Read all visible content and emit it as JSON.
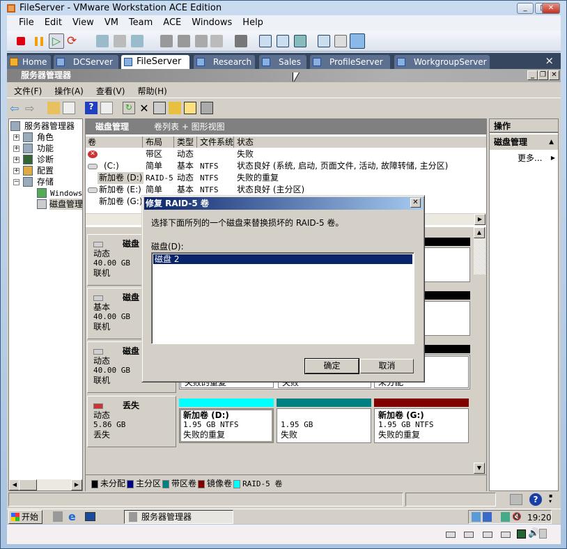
{
  "window": {
    "title": "FileServer - VMware Workstation ACE Edition"
  },
  "menu": [
    "File",
    "Edit",
    "View",
    "VM",
    "Team",
    "ACE",
    "Windows",
    "Help"
  ],
  "tabs": [
    {
      "label": "Home"
    },
    {
      "label": "DCServer"
    },
    {
      "label": "FileServer",
      "active": true
    },
    {
      "label": "Research"
    },
    {
      "label": "Sales"
    },
    {
      "label": "ProfileServer"
    },
    {
      "label": "WorkgroupServer"
    }
  ],
  "tabs_close": "×",
  "guest": {
    "title": "服务器管理器",
    "menu": [
      "文件(F)",
      "操作(A)",
      "查看(V)",
      "帮助(H)"
    ],
    "tree": {
      "root": "服务器管理器",
      "items": [
        "角色",
        "功能",
        "诊断",
        "配置",
        "存储"
      ],
      "children": [
        "Windows",
        "磁盘管理"
      ]
    },
    "center": {
      "title": "磁盘管理",
      "subtitle": "卷列表 + 图形视图",
      "columns": [
        "卷",
        "布局",
        "类型",
        "文件系统",
        "状态"
      ],
      "rows": [
        {
          "volume": "",
          "layout": "带区",
          "type": "动态",
          "fs": "",
          "status": "失败"
        },
        {
          "volume": "(C:)",
          "layout": "简单",
          "type": "基本",
          "fs": "NTFS",
          "status": "状态良好 (系统, 启动, 页面文件, 活动, 故障转储, 主分区)"
        },
        {
          "volume": "新加卷 (D:)",
          "layout": "RAID-5",
          "type": "动态",
          "fs": "NTFS",
          "status": "失败的重复"
        },
        {
          "volume": "新加卷 (E:)",
          "layout": "简单",
          "type": "基本",
          "fs": "NTFS",
          "status": "状态良好 (主分区)"
        },
        {
          "volume": "新加卷 (G:)",
          "layout": "",
          "type": "",
          "fs": "",
          "status": ""
        }
      ],
      "disks": [
        {
          "name": "磁盘",
          "kind": "动态",
          "size": "40.00 GB",
          "state": "联机"
        },
        {
          "name": "磁盘",
          "kind": "基本",
          "size": "40.00 GB",
          "state": "联机"
        },
        {
          "name": "磁盘",
          "kind": "动态",
          "size": "40.00 GB",
          "state": "联机",
          "partitions": [
            "失败的重复",
            "失败",
            "未分配"
          ]
        },
        {
          "name": "丢失",
          "kind": "动态",
          "size": "5.86 GB",
          "state": "丢失",
          "partitions": [
            {
              "name": "新加卷  (D:)",
              "size": "1.95 GB NTFS",
              "status": "失败的重复",
              "color": "#00ffff"
            },
            {
              "name": "",
              "size": "1.95 GB",
              "status": "失败",
              "color": "#008080"
            },
            {
              "name": "新加卷  (G:)",
              "size": "1.95 GB NTFS",
              "status": "失败的重复",
              "color": "#800000"
            }
          ]
        }
      ],
      "legend": [
        {
          "label": "未分配",
          "color": "#000000"
        },
        {
          "label": "主分区",
          "color": "#000080"
        },
        {
          "label": "带区卷",
          "color": "#008080"
        },
        {
          "label": "镜像卷",
          "color": "#800000"
        },
        {
          "label": "RAID-5 卷",
          "color": "#00ffff"
        }
      ]
    },
    "actions": {
      "title": "操作",
      "section": "磁盘管理",
      "more": "更多..."
    },
    "taskbar": {
      "start": "开始",
      "task": "服务器管理器",
      "clock": "19:20"
    }
  },
  "dialog": {
    "title": "修复 RAID-5 卷",
    "instruction": "选择下面所列的一个磁盘来替换损坏的 RAID-5 卷。",
    "list_label": "磁盘(D):",
    "items": [
      "磁盘 2"
    ],
    "ok": "确定",
    "cancel": "取消"
  }
}
